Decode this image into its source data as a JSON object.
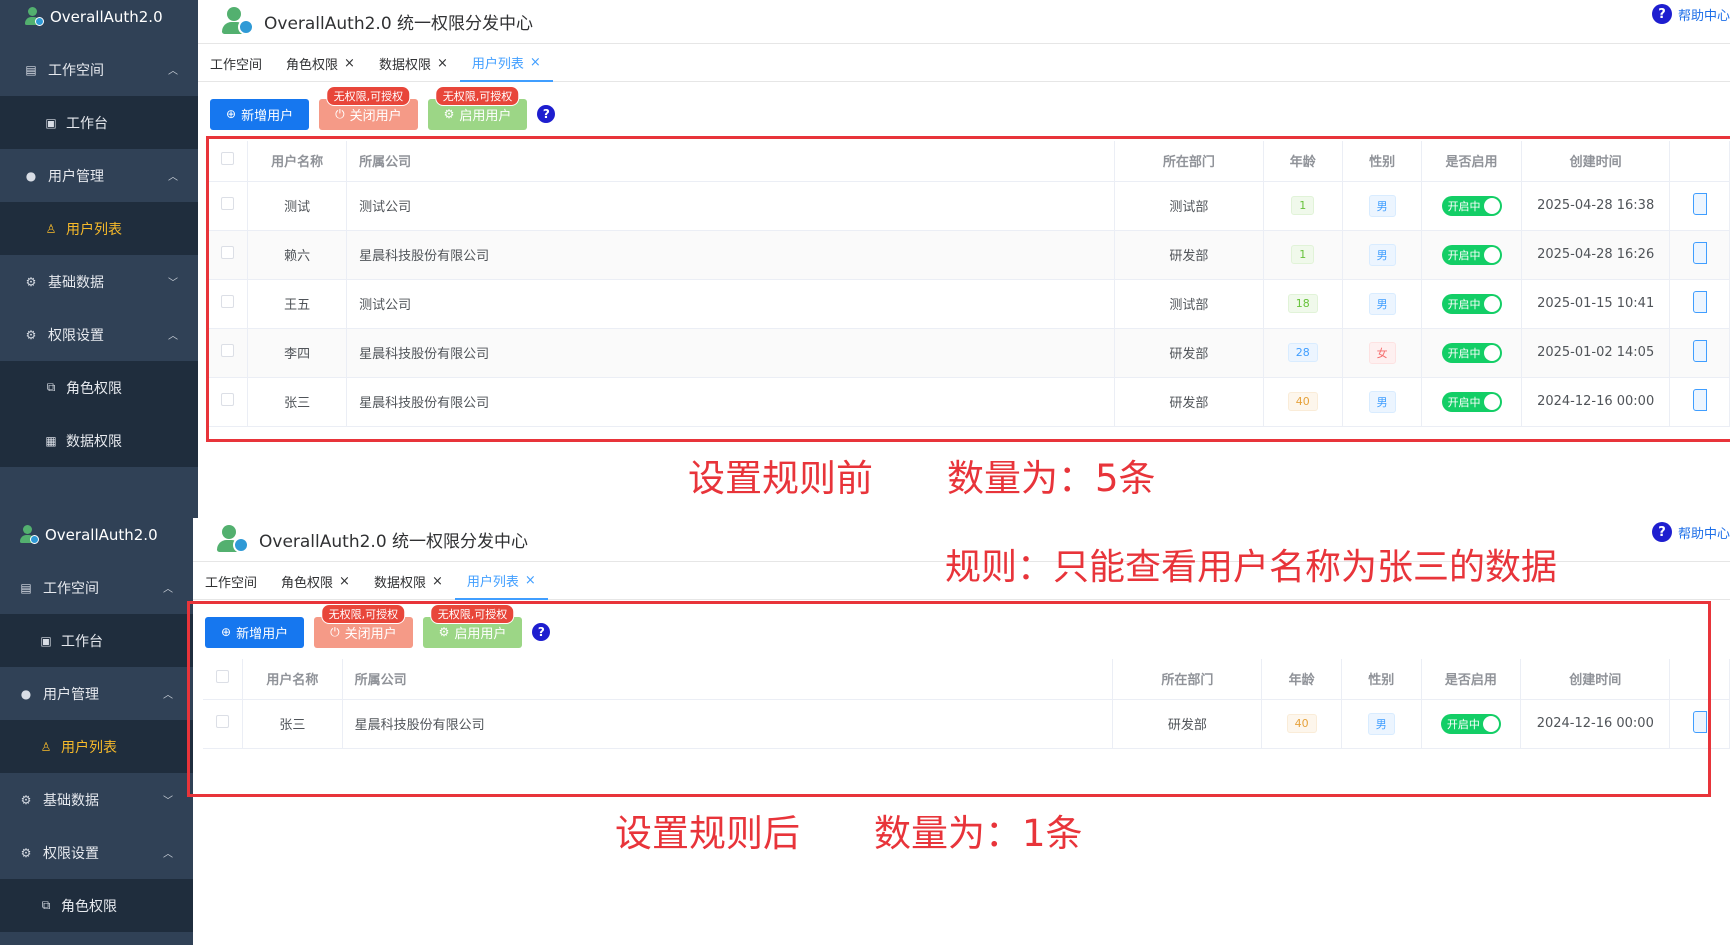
{
  "app_name": "OverallAuth2.0",
  "header_title": "OverallAuth2.0 统一权限分发中心",
  "help_label": "帮助中心",
  "sidebar_top": {
    "workspace": "工作空间",
    "workbench": "工作台",
    "user_mgmt": "用户管理",
    "user_list": "用户列表",
    "basic_data": "基础数据",
    "perm_settings": "权限设置",
    "role_perm": "角色权限",
    "data_perm": "数据权限"
  },
  "sidebar_bottom": {
    "workspace": "工作空间",
    "workbench": "工作台",
    "user_mgmt": "用户管理",
    "user_list": "用户列表",
    "basic_data": "基础数据",
    "perm_settings": "权限设置",
    "role_perm": "角色权限"
  },
  "tabs": [
    "工作空间",
    "角色权限",
    "数据权限",
    "用户列表"
  ],
  "toolbar": {
    "add_user": "新增用户",
    "close_user": "关闭用户",
    "enable_user": "启用用户",
    "badge": "无权限,可授权",
    "help": "?"
  },
  "table": {
    "columns": [
      "用户名称",
      "所属公司",
      "所在部门",
      "年龄",
      "性别",
      "是否启用",
      "创建时间"
    ],
    "switch_label": "开启中"
  },
  "rows_before": [
    {
      "name": "测试",
      "company": "测试公司",
      "dept": "测试部",
      "age": "1",
      "gender": "男",
      "created": "2025-04-28 16:38"
    },
    {
      "name": "赖六",
      "company": "星晨科技股份有限公司",
      "dept": "研发部",
      "age": "1",
      "gender": "男",
      "created": "2025-04-28 16:26"
    },
    {
      "name": "王五",
      "company": "测试公司",
      "dept": "测试部",
      "age": "18",
      "gender": "男",
      "created": "2025-01-15 10:41"
    },
    {
      "name": "李四",
      "company": "星晨科技股份有限公司",
      "dept": "研发部",
      "age": "28",
      "gender": "女",
      "created": "2025-01-02 14:05"
    },
    {
      "name": "张三",
      "company": "星晨科技股份有限公司",
      "dept": "研发部",
      "age": "40",
      "gender": "男",
      "created": "2024-12-16 00:00"
    }
  ],
  "rows_after": [
    {
      "name": "张三",
      "company": "星晨科技股份有限公司",
      "dept": "研发部",
      "age": "40",
      "gender": "男",
      "created": "2024-12-16 00:00"
    }
  ],
  "annotations": {
    "before": "设置规则前　　数量为：5条",
    "rule": "规则：只能查看用户名称为张三的数据",
    "after": "设置规则后　　数量为：1条"
  },
  "colors": {
    "sidebar_bg": "#304156",
    "active_menu": "#f7ba2a",
    "primary": "#1677ef",
    "annotation_red": "#e8343a",
    "switch_on": "#13ce66"
  }
}
